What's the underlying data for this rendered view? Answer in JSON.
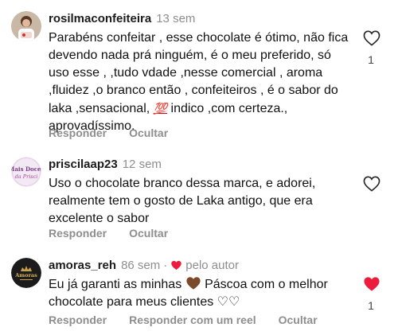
{
  "comments": [
    {
      "username": "rosilmaconfeiteira",
      "time": "13 sem",
      "text_before_emoji": "Parabéns confeitar , esse chocolate é ótimo, não fica devendo nada prá ninguém, é o meu preferido, só uso esse , ,tudo vdade ,nesse comercial , aroma ,fluidez ,o branco então , confeiteiros , é o sabor do laka ,sensacional, ",
      "emoji": "💯",
      "text_after_emoji": " indico ,com certeza., aprovadíssimo.",
      "actions": [
        "Responder",
        "Ocultar"
      ],
      "liked": false,
      "like_count": "1"
    },
    {
      "username": "priscilaap23",
      "time": "12 sem",
      "avatar_text": [
        "Mais Doces",
        "da Prisci"
      ],
      "text": "Uso o chocolate branco dessa marca, e adorei, realmente tem o gosto de Laka antigo, que era excelente o sabor",
      "actions": [
        "Responder",
        "Ocultar"
      ],
      "liked": false
    },
    {
      "username": "amoras_reh",
      "time": "86 sem",
      "author_badge": "pelo autor",
      "avatar_text": "Amoras",
      "text_before_emoji": "Eu já garanti as minhas ",
      "text_after_emoji": "  Páscoa com o melhor chocolate para meus clientes ♡♡",
      "actions": [
        "Responder",
        "Responder com um reel",
        "Ocultar"
      ],
      "liked": true,
      "like_count": "1"
    }
  ],
  "colors": {
    "muted": "#8e8e8e",
    "like_red": "#ed1c3c",
    "brown_heart": "#7b4a2a"
  }
}
